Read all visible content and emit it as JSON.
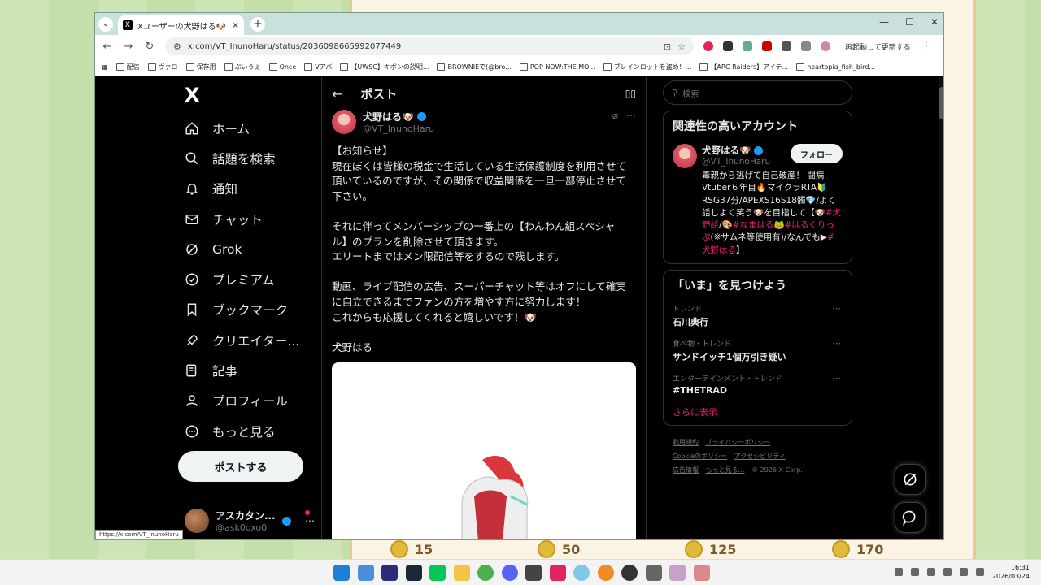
{
  "browser": {
    "tab_title": "Xユーザーの犬野はる🐶さん「お知...",
    "url": "x.com/VT_InunoHaru/status/2036098665992077449",
    "restart_label": "再起動して更新する",
    "status_url": "https://x.com/VT_InunoHaru",
    "bookmarks": [
      "配信",
      "ヴァロ",
      "保存用",
      "ぷいうぇ",
      "Once",
      "Vアバ",
      "【UWSC】キボンの説明...",
      "BROWNIEで(@bro...",
      "POP NOW:THE MO...",
      "ブレインロットを盗め！...",
      "【ARC Raiders】アイテ...",
      "heartopia_fish_bird..."
    ]
  },
  "nav": {
    "logo": "X",
    "items": [
      {
        "label": "ホーム",
        "icon": "home-icon"
      },
      {
        "label": "話題を検索",
        "icon": "search-icon"
      },
      {
        "label": "通知",
        "icon": "bell-icon"
      },
      {
        "label": "チャット",
        "icon": "mail-icon"
      },
      {
        "label": "Grok",
        "icon": "grok-icon"
      },
      {
        "label": "プレミアム",
        "icon": "verified-icon"
      },
      {
        "label": "ブックマーク",
        "icon": "bookmark-icon"
      },
      {
        "label": "クリエイター...",
        "icon": "rocket-icon"
      },
      {
        "label": "記事",
        "icon": "article-icon"
      },
      {
        "label": "プロフィール",
        "icon": "person-icon"
      },
      {
        "label": "もっと見る",
        "icon": "more-circle-icon"
      }
    ],
    "post_button": "ポストする",
    "account": {
      "name": "アスカタン...",
      "handle": "@ask0oxo0"
    }
  },
  "post": {
    "header_title": "ポスト",
    "author_name": "犬野はる🐶",
    "author_handle": "@VT_InunoHaru",
    "lines": [
      "【お知らせ】",
      "現在ぼくは皆様の税金で生活している生活保護制度を利用させて",
      "頂いているのですが、その関係で収益関係を一旦一部停止させて",
      "下さい。",
      "",
      "それに伴ってメンバーシップの一番上の【わんわん組スペシャ",
      "ル】のプランを削除させて頂きます。",
      "エリートまではメン限配信等をするので残します。",
      "",
      "動画、ライブ配信の広告、スーパーチャット等はオフにして確実",
      "に自立できるまでファンの方を増やす方に努力します！",
      "これからも応援してくれると嬉しいです！🐶",
      "",
      "犬野はる"
    ]
  },
  "sidebar": {
    "search_placeholder": "検索",
    "relevant_title": "関連性の高いアカウント",
    "rec": {
      "name": "犬野はる🐶",
      "handle": "@VT_InunoHaru",
      "follow": "フォロー",
      "bio_1": "毒親から逃げて自己破産！ 闘病Vtuber６年目🔥マイクラRTA🔰RSG37分/APEXS16S18髑💎/よく話しよく笑う🐶を目指して【🐶",
      "bio_link_1": "#犬野絵",
      "bio_mid_1": "/🎨",
      "bio_link_2": "#なまはる",
      "bio_mid_2": "🐸",
      "bio_link_3": "#はるくりっぷ",
      "bio_mid_3": "(※サムネ等使用有)/なんでも▶",
      "bio_link_4": "#犬野はる",
      "bio_end": "】"
    },
    "trends_title": "「いま」を見つけよう",
    "trends": [
      {
        "category": "トレンド",
        "name": "石川典行"
      },
      {
        "category": "食べ物・トレンド",
        "name": "サンドイッチ1個万引き疑い"
      },
      {
        "category": "エンターテインメント・トレンド",
        "name": "#THETRAD"
      }
    ],
    "show_more": "さらに表示",
    "footer": [
      "利用規約",
      "プライバシーポリシー",
      "Cookieのポリシー",
      "アクセシビリティ",
      "広告情報",
      "もっと見る…",
      "© 2026 X Corp."
    ]
  },
  "background": {
    "coins": [
      "15",
      "50",
      "125",
      "170"
    ]
  },
  "taskbar": {
    "time": "16:31",
    "date": "2026/03/24"
  }
}
